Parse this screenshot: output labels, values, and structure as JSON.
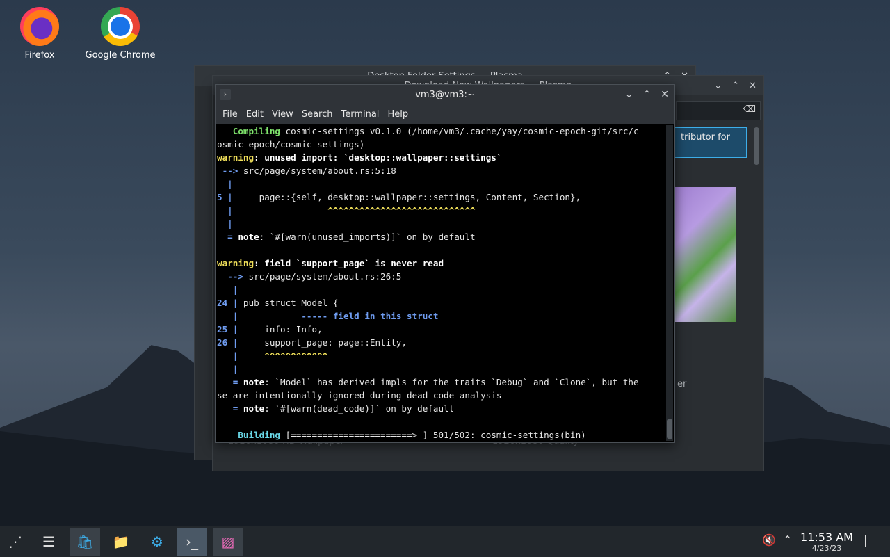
{
  "desktop": {
    "icons": [
      {
        "label": "Firefox"
      },
      {
        "label": "Google Chrome"
      }
    ]
  },
  "windows": {
    "back1": {
      "title": "Desktop Folder Settings — Plasma"
    },
    "back2": {
      "title": "Download New Wallpapers — Plasma",
      "partial_text": "tributor for",
      "partial_text2": "er",
      "foot_left": "1920x1080 HD Wallpaper",
      "foot_right": "1920x1080 Quality"
    }
  },
  "terminal": {
    "title": "vm3@vm3:~",
    "menu": [
      "File",
      "Edit",
      "View",
      "Search",
      "Terminal",
      "Help"
    ],
    "lines": {
      "l1a": "   Compiling",
      "l1b": " cosmic-settings v0.1.0 (/home/vm3/.cache/yay/cosmic-epoch-git/src/c",
      "l2": "osmic-epoch/cosmic-settings)",
      "l3a": "warning",
      "l3b": ": unused import: `desktop::wallpaper::settings`",
      "l4a": " -->",
      "l4b": " src/page/system/about.rs:5:18",
      "l5": "  |",
      "l6a": "5 |",
      "l6b": "     page::{self, desktop::wallpaper::settings, Content, Section},",
      "l7a": "  |",
      "l7b": "                  ^^^^^^^^^^^^^^^^^^^^^^^^^^^^",
      "l8": "  |",
      "l9a": "  =",
      "l9b": " note",
      "l9c": ": `#[warn(unused_imports)]` on by default",
      "l10": "",
      "l11a": "warning",
      "l11b": ": field `support_page` is never read",
      "l12a": "  -->",
      "l12b": " src/page/system/about.rs:26:5",
      "l13": "   |",
      "l14a": "24 |",
      "l14b": " pub struct Model {",
      "l15a": "   |",
      "l15b": "            -----",
      "l15c": " field in this struct",
      "l16a": "25 |",
      "l16b": "     info: Info,",
      "l17a": "26 |",
      "l17b": "     support_page: page::Entity,",
      "l18a": "   |",
      "l18b": "     ^^^^^^^^^^^^",
      "l19": "   |",
      "l20a": "   =",
      "l20b": " note",
      "l20c": ": `Model` has derived impls for the traits `Debug` and `Clone`, but the",
      "l21": "se are intentionally ignored during dead code analysis",
      "l22a": "   =",
      "l22b": " note",
      "l22c": ": `#[warn(dead_code)]` on by default",
      "l23": "",
      "l24a": "    Building",
      "l24b": " [=======================> ] 501/502: cosmic-settings(bin)"
    }
  },
  "taskbar": {
    "clock_time": "11:53 AM",
    "clock_date": "4/23/23"
  }
}
